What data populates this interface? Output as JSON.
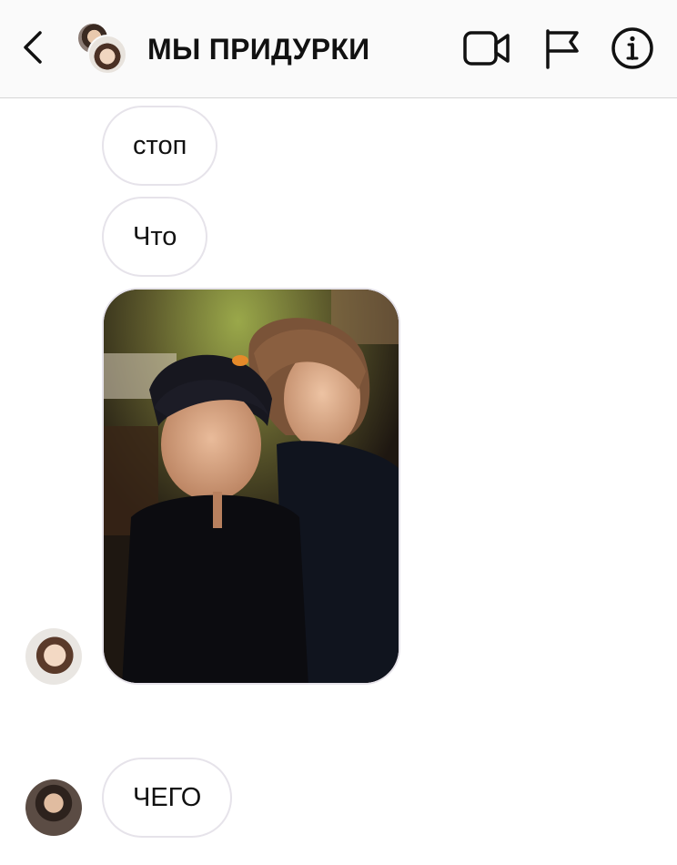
{
  "header": {
    "title": "МЫ ПРИДУРКИ",
    "back_icon": "chevron-left-icon",
    "video_icon": "video-camera-icon",
    "flag_icon": "flag-icon",
    "info_icon": "info-icon"
  },
  "messages": [
    {
      "type": "text",
      "text": "стоп"
    },
    {
      "type": "text",
      "text": "Что"
    },
    {
      "type": "photo",
      "content": "selfie-photo"
    },
    {
      "type": "text",
      "text": "ЧЕГО"
    }
  ],
  "colors": {
    "header_bg": "#fafafa",
    "bubble_border": "#e6e3ea",
    "text": "#111111"
  }
}
